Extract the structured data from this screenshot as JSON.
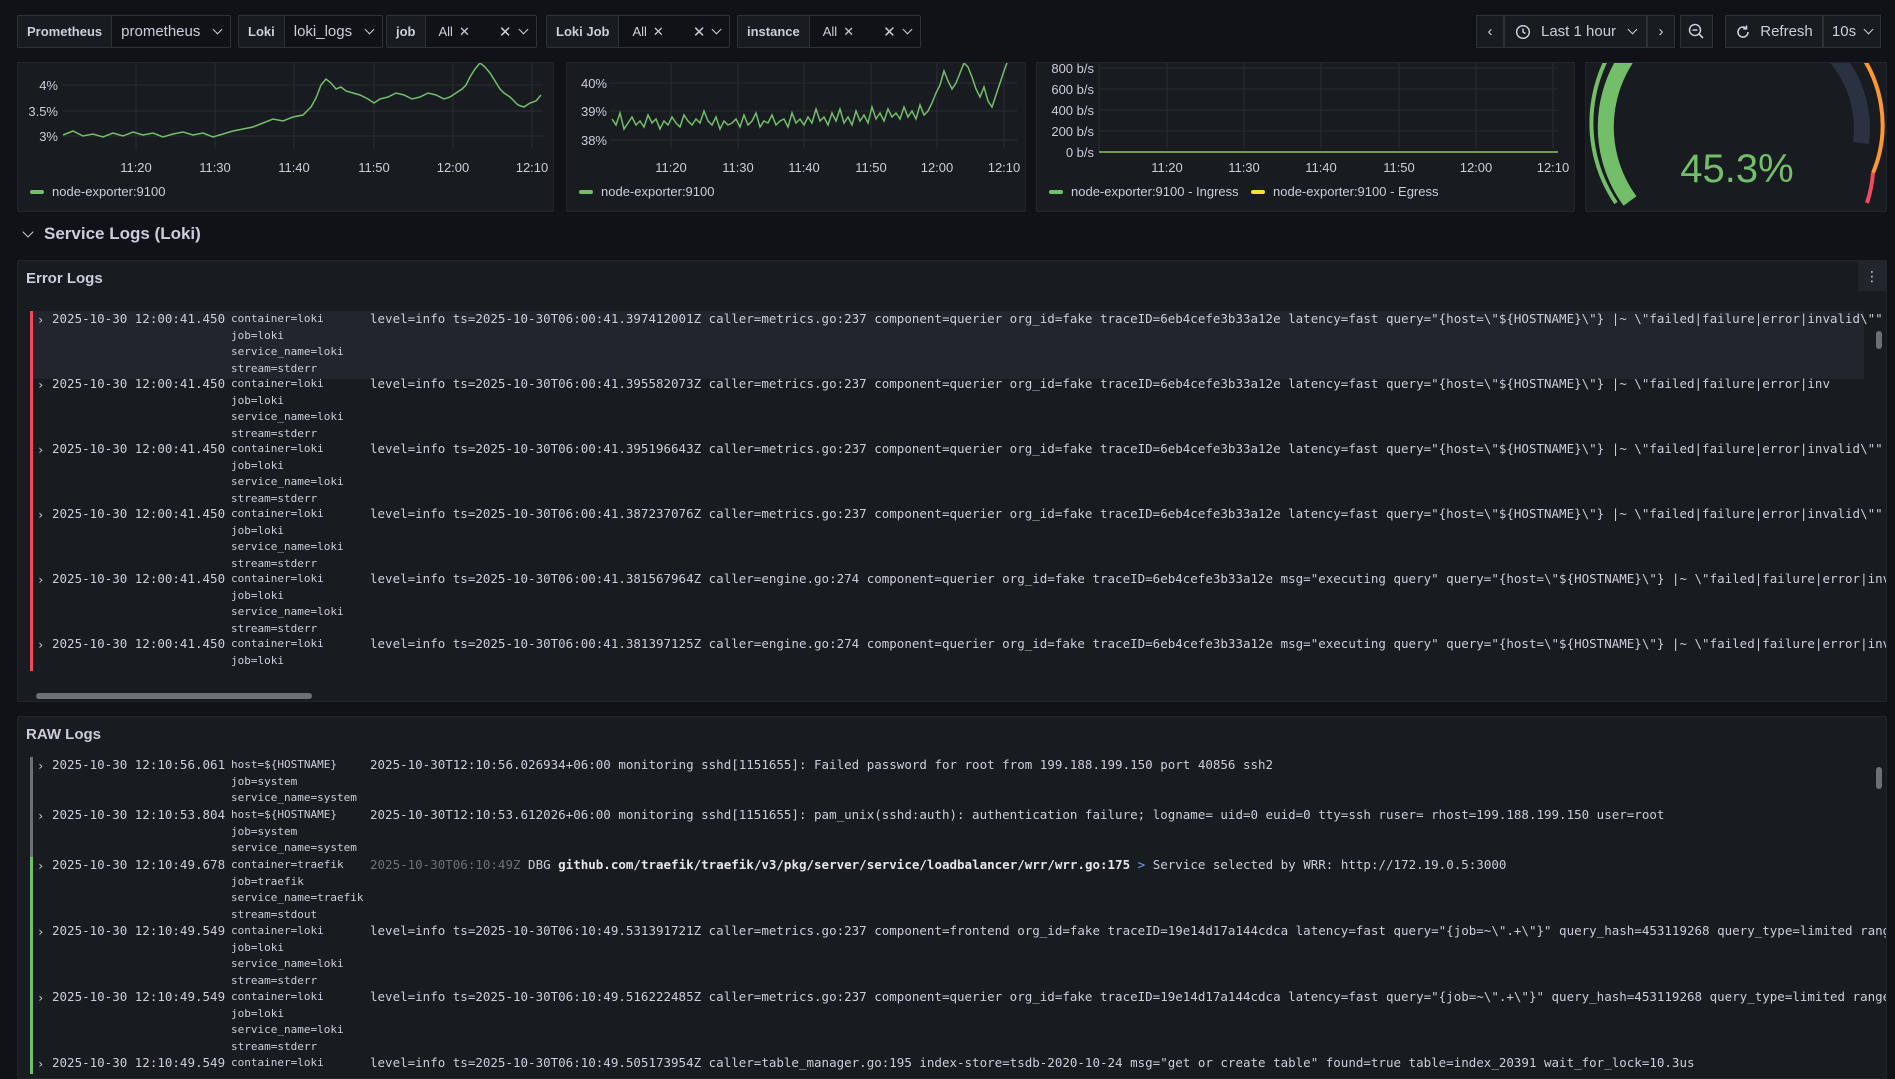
{
  "variables": {
    "prometheus": {
      "label": "Prometheus",
      "value": "prometheus"
    },
    "loki": {
      "label": "Loki",
      "value": "loki_logs"
    },
    "job": {
      "label": "job",
      "value": "All"
    },
    "loki_job": {
      "label": "Loki Job",
      "value": "All"
    },
    "instance": {
      "label": "instance",
      "value": "All"
    }
  },
  "time_picker": {
    "range": "Last 1 hour",
    "refresh_label": "Refresh",
    "interval": "10s"
  },
  "panels": {
    "cpu": {
      "y_ticks": [
        "4%",
        "3.5%",
        "3%"
      ],
      "x_ticks": [
        "11:20",
        "11:30",
        "11:40",
        "11:50",
        "12:00",
        "12:10"
      ],
      "legend": "node-exporter:9100",
      "series_color": "#73bf69"
    },
    "memory": {
      "y_ticks": [
        "40%",
        "39%",
        "38%"
      ],
      "x_ticks": [
        "11:20",
        "11:30",
        "11:40",
        "11:50",
        "12:00",
        "12:10"
      ],
      "legend": "node-exporter:9100",
      "series_color": "#73bf69"
    },
    "network": {
      "y_ticks": [
        "800 b/s",
        "600 b/s",
        "400 b/s",
        "200 b/s",
        "0 b/s"
      ],
      "x_ticks": [
        "11:20",
        "11:30",
        "11:40",
        "11:50",
        "12:00",
        "12:10"
      ],
      "legend_ingress": "node-exporter:9100 - Ingress",
      "legend_egress": "node-exporter:9100 - Egress",
      "ingress_color": "#73bf69",
      "egress_color": "#fade2a"
    },
    "gauge": {
      "value": "45.3%",
      "fraction": 0.453,
      "color": "#73bf69"
    }
  },
  "row": {
    "title": "Service Logs (Loki)"
  },
  "error_logs": {
    "title": "Error Logs",
    "rows": [
      {
        "ts": "2025-10-30 12:00:41.450",
        "labels": [
          "container=loki",
          "job=loki",
          "service_name=loki",
          "stream=stderr"
        ],
        "msg": "level=info ts=2025-10-30T06:00:41.397412001Z caller=metrics.go:237 component=querier org_id=fake traceID=6eb4cefe3b33a12e latency=fast query=\"{host=\\\"${HOSTNAME}\\\"} |~ \\\"failed|failure|error|invalid\\\"\" que"
      },
      {
        "ts": "2025-10-30 12:00:41.450",
        "labels": [
          "container=loki",
          "job=loki",
          "service_name=loki",
          "stream=stderr"
        ],
        "msg": "level=info ts=2025-10-30T06:00:41.395582073Z caller=metrics.go:237 component=querier org_id=fake traceID=6eb4cefe3b33a12e latency=fast query=\"{host=\\\"${HOSTNAME}\\\"} |~ \\\"failed|failure|error|inv"
      },
      {
        "ts": "2025-10-30 12:00:41.450",
        "labels": [
          "container=loki",
          "job=loki",
          "service_name=loki",
          "stream=stderr"
        ],
        "msg": "level=info ts=2025-10-30T06:00:41.395196643Z caller=metrics.go:237 component=querier org_id=fake traceID=6eb4cefe3b33a12e latency=fast query=\"{host=\\\"${HOSTNAME}\\\"} |~ \\\"failed|failure|error|invalid\\\"\" que"
      },
      {
        "ts": "2025-10-30 12:00:41.450",
        "labels": [
          "container=loki",
          "job=loki",
          "service_name=loki",
          "stream=stderr"
        ],
        "msg": "level=info ts=2025-10-30T06:00:41.387237076Z caller=metrics.go:237 component=querier org_id=fake traceID=6eb4cefe3b33a12e latency=fast query=\"{host=\\\"${HOSTNAME}\\\"} |~ \\\"failed|failure|error|invalid\\\"\" que"
      },
      {
        "ts": "2025-10-30 12:00:41.450",
        "labels": [
          "container=loki",
          "job=loki",
          "service_name=loki",
          "stream=stderr"
        ],
        "msg": "level=info ts=2025-10-30T06:00:41.381567964Z caller=engine.go:274 component=querier org_id=fake traceID=6eb4cefe3b33a12e msg=\"executing query\" query=\"{host=\\\"${HOSTNAME}\\\"} |~ \\\"failed|failure|error|invali"
      },
      {
        "ts": "2025-10-30 12:00:41.450",
        "labels": [
          "container=loki",
          "job=loki"
        ],
        "msg": "level=info ts=2025-10-30T06:00:41.381397125Z caller=engine.go:274 component=querier org_id=fake traceID=6eb4cefe3b33a12e msg=\"executing query\" query=\"{host=\\\"${HOSTNAME}\\\"} |~ \\\"failed|failure|error|invali"
      }
    ]
  },
  "raw_logs": {
    "title": "RAW Logs",
    "rows": [
      {
        "ts": "2025-10-30 12:10:56.061",
        "labels": [
          "host=${HOSTNAME}",
          "job=system",
          "service_name=system"
        ],
        "msg": "2025-10-30T12:10:56.026934+06:00 monitoring sshd[1151655]: Failed password for root from 199.188.199.150 port 40856 ssh2"
      },
      {
        "ts": "2025-10-30 12:10:53.804",
        "labels": [
          "host=${HOSTNAME}",
          "job=system",
          "service_name=system"
        ],
        "msg": "2025-10-30T12:10:53.612026+06:00 monitoring sshd[1151655]: pam_unix(sshd:auth): authentication failure; logname= uid=0 euid=0 tty=ssh ruser= rhost=199.188.199.150  user=root"
      },
      {
        "ts": "2025-10-30 12:10:49.678",
        "labels": [
          "container=traefik",
          "job=traefik",
          "service_name=traefik",
          "stream=stdout"
        ],
        "msg_time": "2025-10-30T06:10:49Z",
        "msg_level": "DBG",
        "msg_source": "github.com/traefik/traefik/v3/pkg/server/service/loadbalancer/wrr/wrr.go:175",
        "msg_arrow": ">",
        "msg_text": "Service selected by WRR: http://172.19.0.5:3000"
      },
      {
        "ts": "2025-10-30 12:10:49.549",
        "labels": [
          "container=loki",
          "job=loki",
          "service_name=loki",
          "stream=stderr"
        ],
        "msg": "level=info ts=2025-10-30T06:10:49.531391721Z caller=metrics.go:237 component=frontend org_id=fake traceID=19e14d17a144cdca latency=fast query=\"{job=~\\\".+\\\"}\" query_hash=453119268 query_type=limited range_t"
      },
      {
        "ts": "2025-10-30 12:10:49.549",
        "labels": [
          "container=loki",
          "job=loki",
          "service_name=loki",
          "stream=stderr"
        ],
        "msg": "level=info ts=2025-10-30T06:10:49.516222485Z caller=metrics.go:237 component=querier org_id=fake traceID=19e14d17a144cdca latency=fast query=\"{job=~\\\".+\\\"}\" query_hash=453119268 query_type=limited range_ty"
      },
      {
        "ts": "2025-10-30 12:10:49.549",
        "labels": [
          "container=loki"
        ],
        "msg": "level=info ts=2025-10-30T06:10:49.505173954Z caller=table_manager.go:195 index-store=tsdb-2020-10-24 msg=\"get or create table\" found=true table=index_20391 wait_for_lock=10.3us"
      }
    ]
  }
}
